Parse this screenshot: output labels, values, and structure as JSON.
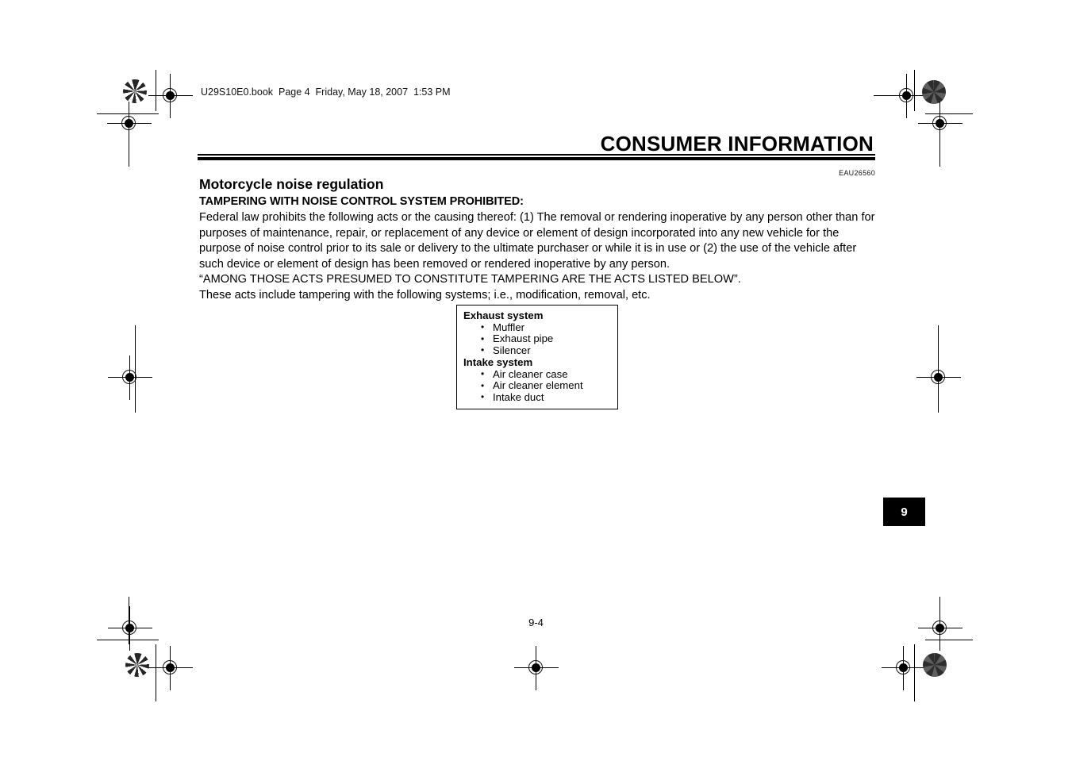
{
  "header": {
    "filename_line": "U29S10E0.book  Page 4  Friday, May 18, 2007  1:53 PM"
  },
  "chapter": {
    "title": "CONSUMER INFORMATION",
    "tab_number": "9",
    "doc_code": "EAU26560"
  },
  "content": {
    "section_heading": "Motorcycle noise regulation",
    "sub_heading": "TAMPERING WITH NOISE CONTROL SYSTEM PROHIBITED:",
    "paragraphs": [
      "Federal law prohibits the following acts or the causing thereof: (1) The removal or rendering inoperative by any person other than for purposes of maintenance, repair, or replacement of any device or element of design incorporated into any new vehicle for the purpose of noise control prior to its sale or delivery to the ultimate purchaser or while it is in use or (2) the use of the vehicle after such device or element of design has been removed or rendered inoperative by any person.",
      "“AMONG THOSE ACTS PRESUMED TO CONSTITUTE TAMPERING ARE THE ACTS LISTED BELOW”.",
      "These acts include tampering with the following systems; i.e., modification, removal, etc."
    ]
  },
  "system_box": {
    "groups": [
      {
        "title": "Exhaust system",
        "items": [
          "Muffler",
          "Exhaust pipe",
          "Silencer"
        ]
      },
      {
        "title": "Intake system",
        "items": [
          "Air cleaner case",
          "Air cleaner element",
          "Intake duct"
        ]
      }
    ]
  },
  "footer": {
    "page_number": "9-4"
  },
  "colors": {
    "ink": "#000000",
    "paper": "#ffffff",
    "tab_background": "#000000",
    "tab_text": "#ffffff"
  }
}
